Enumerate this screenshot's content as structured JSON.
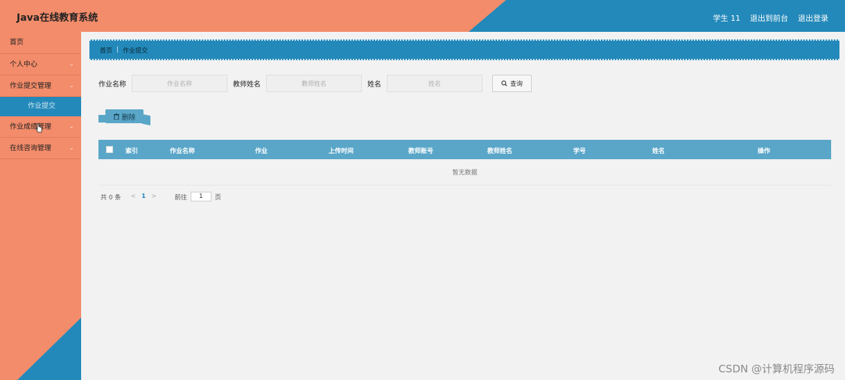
{
  "header": {
    "title": "Java在线教育系统",
    "user": "学生 11",
    "back_front": "退出到前台",
    "logout": "退出登录"
  },
  "sidebar": {
    "items": [
      {
        "label": "首页"
      },
      {
        "label": "个人中心",
        "arrow": "⌄"
      },
      {
        "label": "作业提交管理",
        "arrow": "⌄"
      },
      {
        "label": "作业提交"
      },
      {
        "label": "作业成绩管理",
        "arrow": "⌄"
      },
      {
        "label": "在线咨询管理",
        "arrow": "⌄"
      }
    ]
  },
  "breadcrumb": {
    "home": "首页",
    "separator": "|",
    "current": "作业提交"
  },
  "search": {
    "field1_label": "作业名称",
    "field1_placeholder": "作业名称",
    "field2_label": "教师姓名",
    "field2_placeholder": "教师姓名",
    "field3_label": "姓名",
    "field3_placeholder": "姓名",
    "query_label": "查询"
  },
  "toolbar": {
    "delete_label": "删除"
  },
  "table": {
    "columns": [
      "索引",
      "作业名称",
      "作业",
      "上传时间",
      "教师账号",
      "教师姓名",
      "学号",
      "姓名",
      "操作"
    ],
    "empty_text": "暂无数据"
  },
  "pager": {
    "total": "共 0 条",
    "prev": "<",
    "page": "1",
    "next": ">",
    "goto_label": "前往",
    "goto_value": "1",
    "page_unit": "页"
  },
  "watermark": "CSDN @计算机程序源码",
  "colors": {
    "orange": "#f38c6a",
    "blue": "#2389ba",
    "table_header": "#5aa6c8"
  }
}
